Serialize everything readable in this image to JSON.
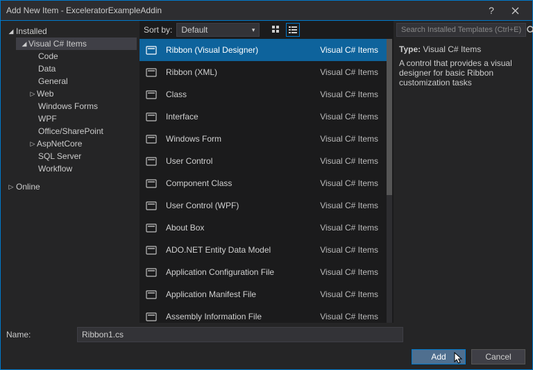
{
  "title": "Add New Item - ExceleratorExampleAddin",
  "sidebar": {
    "installed": "Installed",
    "online": "Online",
    "root": "Visual C# Items",
    "nodes": [
      "Code",
      "Data",
      "General",
      "Web",
      "Windows Forms",
      "WPF",
      "Office/SharePoint",
      "AspNetCore",
      "SQL Server",
      "Workflow"
    ]
  },
  "toolbar": {
    "sortby": "Sort by:",
    "sortvalue": "Default"
  },
  "items": [
    {
      "label": "Ribbon (Visual Designer)",
      "cat": "Visual C# Items",
      "selected": true
    },
    {
      "label": "Ribbon (XML)",
      "cat": "Visual C# Items"
    },
    {
      "label": "Class",
      "cat": "Visual C# Items"
    },
    {
      "label": "Interface",
      "cat": "Visual C# Items"
    },
    {
      "label": "Windows Form",
      "cat": "Visual C# Items"
    },
    {
      "label": "User Control",
      "cat": "Visual C# Items"
    },
    {
      "label": "Component Class",
      "cat": "Visual C# Items"
    },
    {
      "label": "User Control (WPF)",
      "cat": "Visual C# Items"
    },
    {
      "label": "About Box",
      "cat": "Visual C# Items"
    },
    {
      "label": "ADO.NET Entity Data Model",
      "cat": "Visual C# Items"
    },
    {
      "label": "Application Configuration File",
      "cat": "Visual C# Items"
    },
    {
      "label": "Application Manifest File",
      "cat": "Visual C# Items"
    },
    {
      "label": "Assembly Information File",
      "cat": "Visual C# Items"
    }
  ],
  "search": {
    "placeholder": "Search Installed Templates (Ctrl+E)"
  },
  "detail": {
    "typelabel": "Type:",
    "typeval": "Visual C# Items",
    "desc": "A control that provides a visual designer for basic Ribbon customization tasks"
  },
  "namerow": {
    "label": "Name:",
    "value": "Ribbon1.cs"
  },
  "buttons": {
    "add": "Add",
    "cancel": "Cancel"
  }
}
